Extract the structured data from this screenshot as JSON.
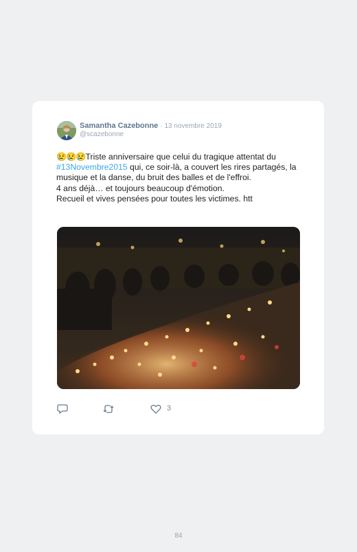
{
  "tweet": {
    "author_name": "Samantha Cazebonne",
    "date": "· 13 novembre 2019",
    "handle": "@scazebonne",
    "emojis": "😢😢😢",
    "text_part1": "Triste anniversaire que celui du tragique attentat du ",
    "hashtag": "#13Novembre2015",
    "text_part2": " qui, ce soir-là, a couvert les rires partagés, la musique et la danse, du bruit des balles et de l'effroi.",
    "line2": "4 ans déjà… et toujours beaucoup d'émotion.",
    "line3": "Recueil et vives pensées pour toutes les victimes. htt",
    "like_count": "3"
  },
  "icons": {
    "reply": "reply-icon",
    "retweet": "retweet-icon",
    "like": "heart-icon"
  },
  "page_number": "84"
}
